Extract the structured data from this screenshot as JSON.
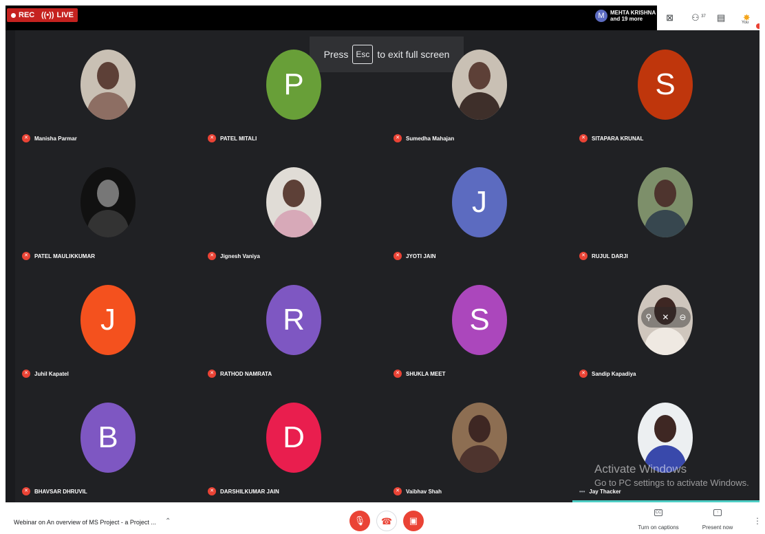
{
  "topbar": {
    "rec": "REC",
    "live": "LIVE",
    "presenter_initial": "M",
    "presenter_line1": "MEHTA KRISHNA",
    "presenter_line2": "and 19 more",
    "participants_count": "37",
    "you_label": "You"
  },
  "toast": {
    "before": "Press",
    "key": "Esc",
    "after": "to exit full screen"
  },
  "participants": [
    {
      "name": "Manisha Parmar",
      "initial": "",
      "color": ""
    },
    {
      "name": "PATEL MITALI",
      "initial": "P",
      "color": "#689f38"
    },
    {
      "name": "Sumedha Mahajan",
      "initial": "",
      "color": ""
    },
    {
      "name": "SITAPARA KRUNAL",
      "initial": "S",
      "color": "#bf360c"
    },
    {
      "name": "PATEL MAULIKKUMAR",
      "initial": "",
      "color": ""
    },
    {
      "name": "Jignesh Vaniya",
      "initial": "",
      "color": ""
    },
    {
      "name": "JYOTI JAIN",
      "initial": "J",
      "color": "#5c6bc0"
    },
    {
      "name": "RUJUL DARJI",
      "initial": "",
      "color": ""
    },
    {
      "name": "Juhil Kapatel",
      "initial": "J",
      "color": "#f4511e"
    },
    {
      "name": "RATHOD NAMRATA",
      "initial": "R",
      "color": "#7e57c2"
    },
    {
      "name": "SHUKLA MEET",
      "initial": "S",
      "color": "#ab47bc"
    },
    {
      "name": "Sandip Kapadiya",
      "initial": "",
      "color": ""
    },
    {
      "name": "BHAVSAR DHRUVIL",
      "initial": "B",
      "color": "#7e57c2"
    },
    {
      "name": "DARSHILKUMAR JAIN",
      "initial": "D",
      "color": "#e91e4e"
    },
    {
      "name": "Vaibhav Shah",
      "initial": "",
      "color": ""
    },
    {
      "name": "Jay Thacker",
      "initial": "",
      "color": ""
    }
  ],
  "typing_indicator": "•••",
  "watermark": {
    "title": "Activate Windows",
    "sub": "Go to PC settings to activate Windows."
  },
  "bottombar": {
    "meeting_title": "Webinar on An overview of MS Project - a Project ...",
    "captions_label": "Turn on captions",
    "captions_icon": "CC",
    "present_label": "Present now",
    "present_icon": "↑"
  },
  "colors": {
    "recording_red": "#c5221f",
    "meet_background": "#202124",
    "speaking_indicator": "#4ecdc4"
  }
}
